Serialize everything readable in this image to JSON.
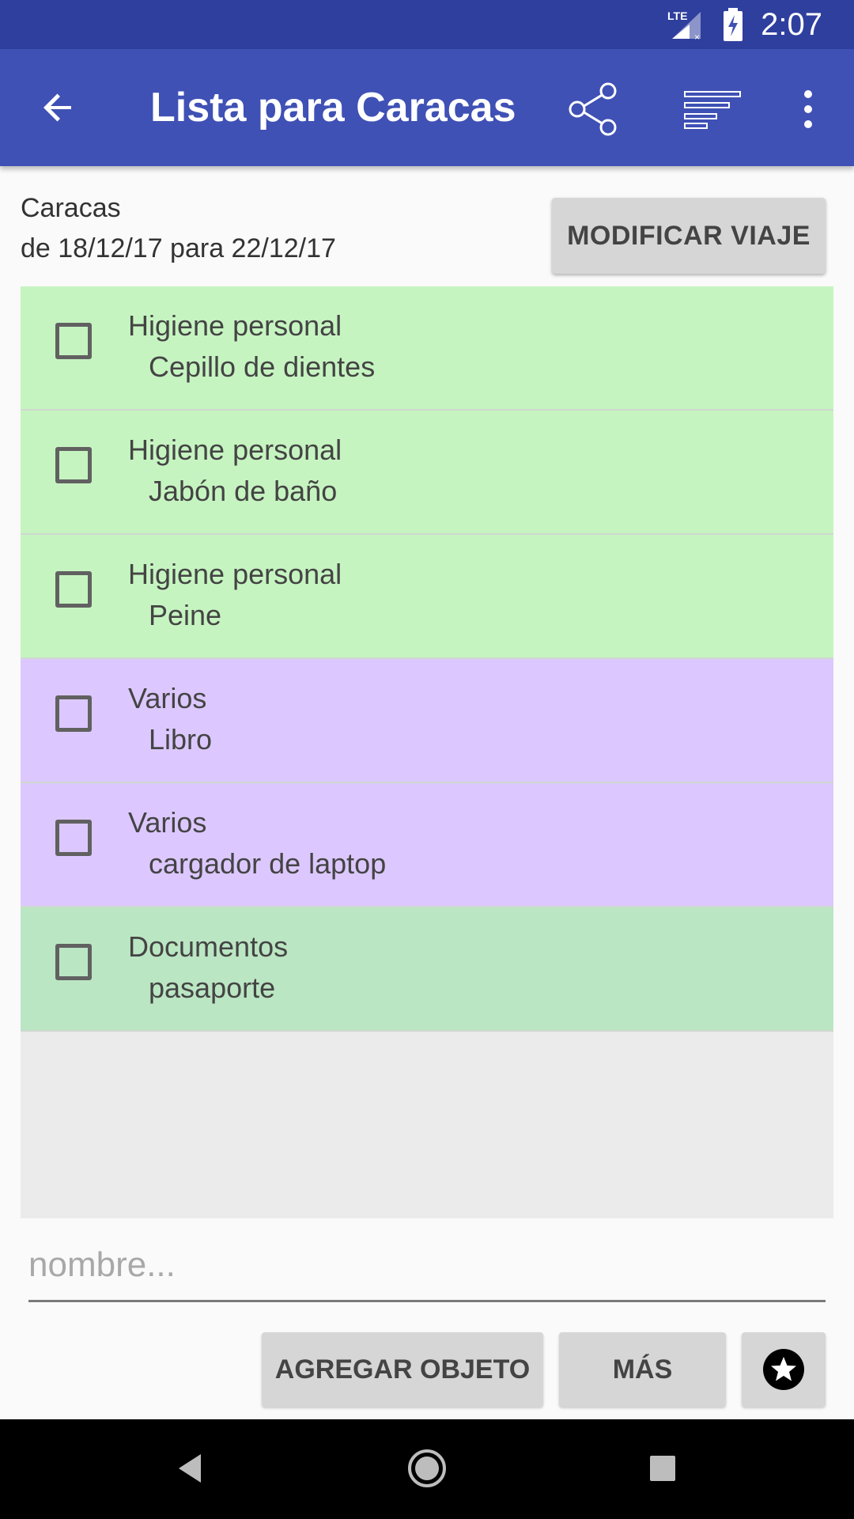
{
  "status_bar": {
    "network": "LTE",
    "time": "2:07",
    "icons": [
      "lte-signal-icon",
      "battery-charging-icon"
    ]
  },
  "app_bar": {
    "title": "Lista para Caracas",
    "icons": [
      "back-arrow-icon",
      "share-icon",
      "sort-icon",
      "more-vert-icon"
    ],
    "color": "#3f51b5"
  },
  "trip": {
    "destination": "Caracas",
    "dates": "de 18/12/17 para 22/12/17",
    "modify_label": "MODIFICAR VIAJE"
  },
  "items": [
    {
      "category": "Higiene personal",
      "name": "Cepillo de dientes",
      "color": "#c6f4c1",
      "checked": false
    },
    {
      "category": "Higiene personal",
      "name": "Jabón de baño",
      "color": "#c6f4c1",
      "checked": false
    },
    {
      "category": "Higiene personal",
      "name": "Peine",
      "color": "#c6f4c1",
      "checked": false
    },
    {
      "category": "Varios",
      "name": "Libro",
      "color": "#dcc8ff",
      "checked": false
    },
    {
      "category": "Varios",
      "name": "cargador de laptop",
      "color": "#dcc8ff",
      "checked": false
    },
    {
      "category": "Documentos",
      "name": "pasaporte",
      "color": "#bbe6c3",
      "checked": false
    }
  ],
  "input": {
    "placeholder": "nombre...",
    "value": ""
  },
  "buttons": {
    "add_item": "AGREGAR OBJETO",
    "more": "MÁS",
    "favorites_icon": "star-circle-icon"
  },
  "nav_bar": {
    "icons": [
      "nav-back-icon",
      "nav-home-icon",
      "nav-recents-icon"
    ]
  }
}
